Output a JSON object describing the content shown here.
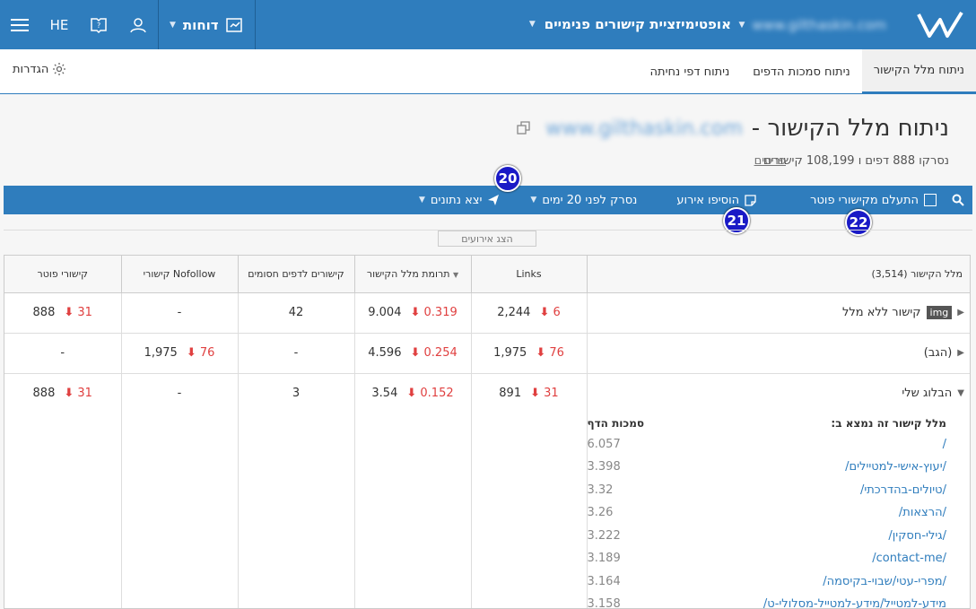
{
  "topbar": {
    "site_name": "www.gilthaskin.com",
    "report_name": "אופטימיזציית קישורים פנימיים",
    "reports_label": "דוחות",
    "language": "HE"
  },
  "tabs": [
    {
      "label": "ניתוח מלל הקישור",
      "active": true
    },
    {
      "label": "ניתוח סמכות הדפים",
      "active": false
    },
    {
      "label": "ניתוח דפי נחיתה",
      "active": false
    }
  ],
  "settings_label": "הגדרות",
  "page": {
    "title_prefix": "ניתוח מלל הקישור -",
    "title_site": "www.gilthaskin.com",
    "subline": "נסרקו 888 דפים ו 108,199 קישורים",
    "details_link": "פרטים"
  },
  "toolbar": {
    "ignore_footer": "התעלם מקישורי פוטר",
    "add_event": "הוסיפו אירוע",
    "crawled_ago": "נסרק לפני 20 ימים",
    "export": "יצא נתונים"
  },
  "badges": {
    "b20": "20",
    "b21": "21",
    "b22": "22"
  },
  "show_events": "הצג אירועים",
  "table": {
    "headers": {
      "anchor": "מלל הקישור (3,514)",
      "links": "Links",
      "contribution": "תרומת מלל הקישור",
      "blocked": "קישורים לדפים חסומים",
      "nofollow": "קישורי Nofollow",
      "footer": "קישורי פוטר"
    },
    "rows": [
      {
        "name": "קישור ללא מלל",
        "img": "img",
        "links": "2,244",
        "links_delta": "6",
        "contribution": "9.004",
        "contribution_delta": "0.319",
        "blocked": "42",
        "nofollow": "-",
        "nofollow_delta": "",
        "footer": "888",
        "footer_delta": "31"
      },
      {
        "name": "(הגב)",
        "img": "",
        "links": "1,975",
        "links_delta": "76",
        "contribution": "4.596",
        "contribution_delta": "0.254",
        "blocked": "-",
        "nofollow": "1,975",
        "nofollow_delta": "76",
        "footer": "-",
        "footer_delta": ""
      },
      {
        "name": "הבלוג שלי",
        "img": "",
        "links": "891",
        "links_delta": "31",
        "contribution": "3.54",
        "contribution_delta": "0.152",
        "blocked": "3",
        "nofollow": "-",
        "nofollow_delta": "",
        "footer": "888",
        "footer_delta": "31"
      }
    ],
    "sub_table": {
      "header_location": "מלל קישור זה נמצא ב:",
      "header_authority": "סמכות הדף",
      "items": [
        {
          "url": "/",
          "score": "6.057"
        },
        {
          "url": "/יעוץ-אישי-למטיילים/",
          "score": "3.398"
        },
        {
          "url": "/טיולים-בהדרכתי/",
          "score": "3.32"
        },
        {
          "url": "/הרצאות/",
          "score": "3.26"
        },
        {
          "url": "/גילי-חסקין/",
          "score": "3.222"
        },
        {
          "url": "/contact-me/",
          "score": "3.189"
        },
        {
          "url": "/מפרי-עטי/שבוי-בקיסמה/",
          "score": "3.164"
        },
        {
          "url": "/מידע-למטייל/מידע-למטייל-מסלולי-ט",
          "score": "3.158"
        }
      ]
    }
  }
}
